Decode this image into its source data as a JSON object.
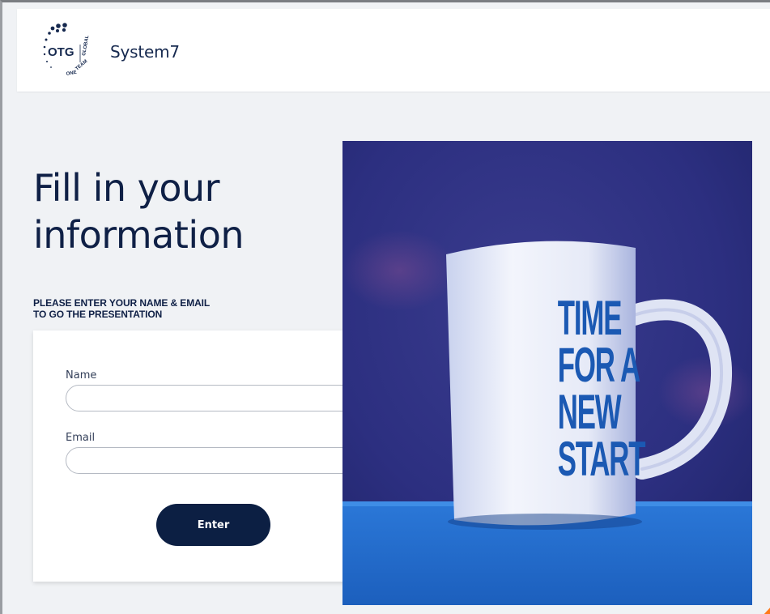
{
  "header": {
    "logo_text": "OTG",
    "logo_ring_text": "ONE TEAM GLOBAL",
    "brand_name": "System7"
  },
  "main": {
    "heading_line1": "Fill in your",
    "heading_line2": "information",
    "subtitle_line1": "PLEASE ENTER YOUR NAME & EMAIL",
    "subtitle_line2": "TO GO THE PRESENTATION"
  },
  "form": {
    "name_label": "Name",
    "name_value": "",
    "email_label": "Email",
    "email_value": "",
    "submit_label": "Enter"
  },
  "hero": {
    "mug_lines": [
      "TIME",
      "FOR A",
      "NEW",
      "START"
    ]
  },
  "colors": {
    "navy": "#0f2046",
    "button": "#0c1f43",
    "page_bg": "#f0f2f5",
    "mug_text": "#1b59b3",
    "accent_orange": "#ff7a1a"
  }
}
